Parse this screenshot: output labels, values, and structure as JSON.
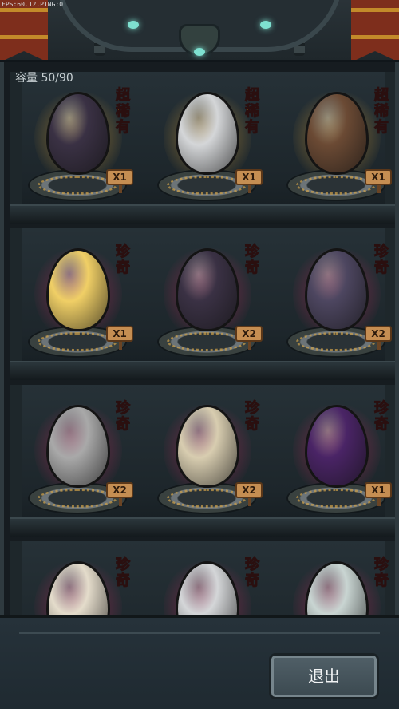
{
  "debug": {
    "fps_text": "FPS:60.12,PING:0"
  },
  "inventory": {
    "capacity_label": "容量 50/90"
  },
  "shelves": [
    {
      "slots": [
        {
          "egg": "spiked-dark-purple-egg",
          "rarity": "超稀有",
          "rarity_color": "#f7a21d",
          "count": "X1",
          "glow": "#f5b237",
          "egg_color": "#3a3144"
        },
        {
          "egg": "white-swirl-egg",
          "rarity": "超稀有",
          "rarity_color": "#f7a21d",
          "count": "X1",
          "glow": "#f5b237",
          "egg_color": "#d4d6d8"
        },
        {
          "egg": "leaf-wrapped-brown-egg",
          "rarity": "超稀有",
          "rarity_color": "#f7a21d",
          "count": "X1",
          "glow": "#f5b237",
          "egg_color": "#6b4a34"
        }
      ]
    },
    {
      "slots": [
        {
          "egg": "golden-helmet-egg",
          "rarity": "珍奇",
          "rarity_color": "#ea4ad6",
          "count": "X1",
          "glow": "#d52b63",
          "egg_color": "#f0cf66"
        },
        {
          "egg": "spiked-dark-purple-egg",
          "rarity": "珍奇",
          "rarity_color": "#ea4ad6",
          "count": "X2",
          "glow": "#d52b63",
          "egg_color": "#3a3144"
        },
        {
          "egg": "horned-grey-purple-egg",
          "rarity": "珍奇",
          "rarity_color": "#ea4ad6",
          "count": "X2",
          "glow": "#d52b63",
          "egg_color": "#4d4660"
        }
      ]
    },
    {
      "slots": [
        {
          "egg": "grey-crested-egg",
          "rarity": "珍奇",
          "rarity_color": "#ea4ad6",
          "count": "X2",
          "glow": "#d52b63",
          "egg_color": "#a9a9a9"
        },
        {
          "egg": "horned-bone-plated-egg",
          "rarity": "珍奇",
          "rarity_color": "#ea4ad6",
          "count": "X2",
          "glow": "#d52b63",
          "egg_color": "#d8cdb0"
        },
        {
          "egg": "purple-flame-egg",
          "rarity": "珍奇",
          "rarity_color": "#ea4ad6",
          "count": "X1",
          "glow": "#d52b63",
          "egg_color": "#4a2466"
        }
      ]
    },
    {
      "slots": [
        {
          "egg": "cream-petal-egg",
          "rarity": "珍奇",
          "rarity_color": "#ea4ad6",
          "count": "",
          "glow": "#d52b63",
          "egg_color": "#e4dccb"
        },
        {
          "egg": "white-swirl-egg",
          "rarity": "珍奇",
          "rarity_color": "#ea4ad6",
          "count": "",
          "glow": "#d52b63",
          "egg_color": "#d4d6d8"
        },
        {
          "egg": "vine-pale-egg",
          "rarity": "珍奇",
          "rarity_color": "#ea4ad6",
          "count": "",
          "glow": "#d52b63",
          "egg_color": "#c9d5d2"
        }
      ]
    }
  ],
  "footer": {
    "exit_label": "退出"
  }
}
